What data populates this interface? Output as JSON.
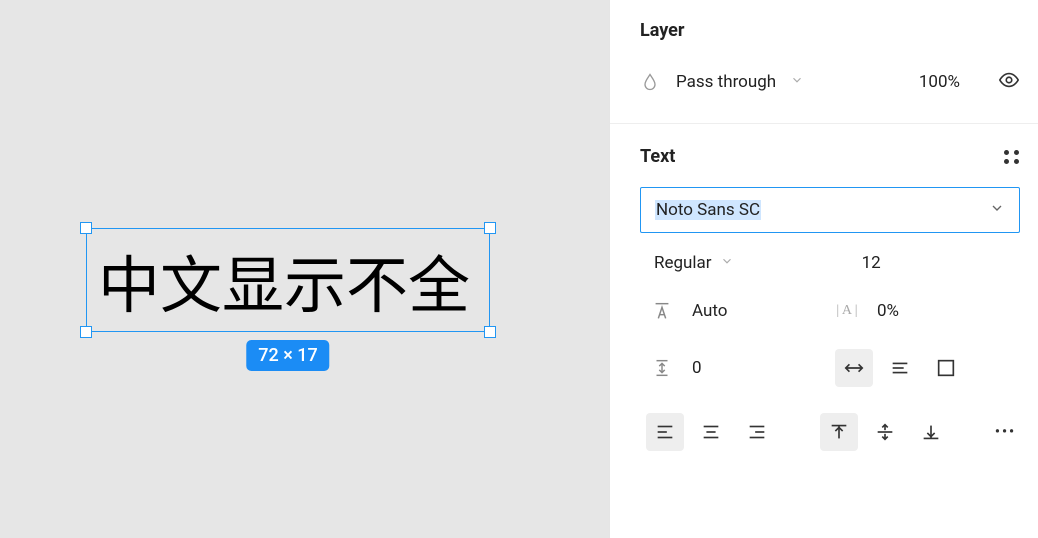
{
  "canvas": {
    "sample_text": "中文显示不全",
    "dimensions_badge": "72 × 17"
  },
  "layer": {
    "title": "Layer",
    "blend_mode": "Pass through",
    "opacity": "100%"
  },
  "text": {
    "title": "Text",
    "font_family": "Noto Sans SC",
    "font_weight": "Regular",
    "font_size": "12",
    "line_height": "Auto",
    "letter_spacing": "0%",
    "paragraph_spacing": "0"
  }
}
